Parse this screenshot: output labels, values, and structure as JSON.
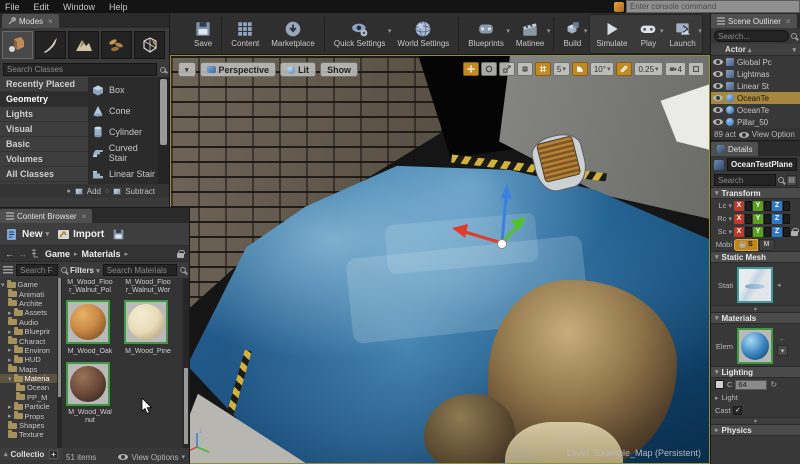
{
  "icons": {
    "caret_down": "▾",
    "caret_right": "▸",
    "caret_up": "▴",
    "caret_left": "◂",
    "check": "✓",
    "arrow_left": "←",
    "arrow_right": "→",
    "close": "×",
    "plus": "+",
    "refresh": "↻",
    "radio_on": "●",
    "radio_off": "○",
    "sort_up": "▲"
  },
  "menu_bar": {
    "items": [
      "File",
      "Edit",
      "Window",
      "Help"
    ],
    "console_placeholder": "Enter console command"
  },
  "toolbar": {
    "buttons": [
      {
        "label": "Save",
        "dropdown": false
      },
      {
        "label": "Content",
        "dropdown": false
      },
      {
        "label": "Marketplace",
        "dropdown": false
      },
      {
        "label": "Quick Settings",
        "dropdown": true
      },
      {
        "label": "World Settings",
        "dropdown": false
      },
      {
        "label": "Blueprints",
        "dropdown": true
      },
      {
        "label": "Matinee",
        "dropdown": true
      },
      {
        "label": "Build",
        "dropdown": true
      },
      {
        "label": "Simulate",
        "dropdown": false
      },
      {
        "label": "Play",
        "dropdown": true
      },
      {
        "label": "Launch",
        "dropdown": true
      }
    ]
  },
  "modes_panel": {
    "tab_label": "Modes",
    "search_placeholder": "Search Classes",
    "categories": [
      {
        "label": "Recently Placed"
      },
      {
        "label": "Geometry"
      },
      {
        "label": "Lights"
      },
      {
        "label": "Visual"
      },
      {
        "label": "Basic"
      },
      {
        "label": "Volumes"
      },
      {
        "label": "All Classes"
      }
    ],
    "geometry_items": [
      {
        "label": "Box"
      },
      {
        "label": "Cone"
      },
      {
        "label": "Cylinder"
      },
      {
        "label": "Curved Stair"
      },
      {
        "label": "Linear Stair"
      }
    ],
    "brush_modes": [
      {
        "label": "Add",
        "selected": true
      },
      {
        "label": "Subtract",
        "selected": false
      }
    ]
  },
  "content_browser": {
    "tab_label": "Content Browser",
    "new_label": "New",
    "import_label": "Import",
    "breadcrumb": [
      "Game",
      "Materials"
    ],
    "search_folders_placeholder": "Search F",
    "filters_label": "Filters",
    "search_assets_placeholder": "Search Materials",
    "folder_tree": [
      {
        "label": "Game",
        "caret": "▾"
      },
      {
        "label": "Animati",
        "caret": ""
      },
      {
        "label": "Archite",
        "caret": ""
      },
      {
        "label": "Assets",
        "caret": "▸"
      },
      {
        "label": "Audio",
        "caret": ""
      },
      {
        "label": "Blueprir",
        "caret": "▸"
      },
      {
        "label": "Charact",
        "caret": ""
      },
      {
        "label": "Environ",
        "caret": "▸"
      },
      {
        "label": "HUD",
        "caret": "▸"
      },
      {
        "label": "Maps",
        "caret": ""
      },
      {
        "label": "Materia",
        "caret": "▾"
      },
      {
        "label": "Ocean",
        "caret": ""
      },
      {
        "label": "PP_M",
        "caret": ""
      },
      {
        "label": "Particle",
        "caret": "▸"
      },
      {
        "label": "Props",
        "caret": "▸"
      },
      {
        "label": "Shapes",
        "caret": ""
      },
      {
        "label": "Texture",
        "caret": ""
      }
    ],
    "collections_label": "Collectio",
    "assets": [
      {
        "label": "M_Wood_Floo r_Walnut_Pol"
      },
      {
        "label": "M_Wood_Floo r_Walnut_Wor"
      },
      {
        "label": "M_Wood_Oak",
        "color": "#c98a45"
      },
      {
        "label": "M_Wood_Pine",
        "color": "#e8dcb8"
      },
      {
        "label": "M_Wood_Wal nut",
        "color": "#6b4a3a"
      }
    ],
    "items_count": "51 items",
    "view_options_label": "View Options"
  },
  "viewport": {
    "perspective_label": "Perspective",
    "lit_label": "Lit",
    "show_label": "Show",
    "snap_values": {
      "grid": "5",
      "rotation": "10°",
      "scale": "0.25",
      "camera_speed": "4"
    },
    "level_label": "Level:",
    "level_name": "Example_Map (Persistent)",
    "accent_border": "#8f8f3a",
    "water_color": "#2e7eb2"
  },
  "scene_outliner": {
    "tab_label": "Scene Outliner",
    "search_placeholder": "Search...",
    "column_header": "Actor",
    "rows": [
      {
        "label": "Global Pc",
        "selected": false
      },
      {
        "label": "Lightmas",
        "selected": false
      },
      {
        "label": "Linear St",
        "selected": false
      },
      {
        "label": "OceanTe",
        "selected": true
      },
      {
        "label": "OceanTe",
        "selected": false
      },
      {
        "label": "Pillar_50",
        "selected": false
      }
    ],
    "footer_count": "89 act",
    "footer_view_options": "View Option",
    "selection_color": "#a5883e"
  },
  "details": {
    "tab_label": "Details",
    "actor_name": "OceanTestPlane",
    "search_placeholder": "Search",
    "transform": {
      "header": "Transform",
      "rows": [
        {
          "label": "Lc"
        },
        {
          "label": "Rc"
        },
        {
          "label": "Sc"
        }
      ],
      "axes": [
        "X",
        "Y",
        "Z"
      ],
      "axis_colors": {
        "x": "#c0392b",
        "y": "#58a020",
        "z": "#2e78c8"
      },
      "mobility_label": "Mobi",
      "mobility_options": [
        {
          "label": "S",
          "selected": true
        },
        {
          "label": "M",
          "selected": false
        }
      ]
    },
    "static_mesh": {
      "header": "Static Mesh",
      "row_label": "Stati"
    },
    "materials": {
      "header": "Materials",
      "row_label": "Elem"
    },
    "lighting": {
      "header": "Lighting",
      "checkbox_label": "C",
      "value": "64",
      "light_label": "Light",
      "cast_label": "Cast"
    },
    "physics": {
      "header": "Physics"
    }
  }
}
